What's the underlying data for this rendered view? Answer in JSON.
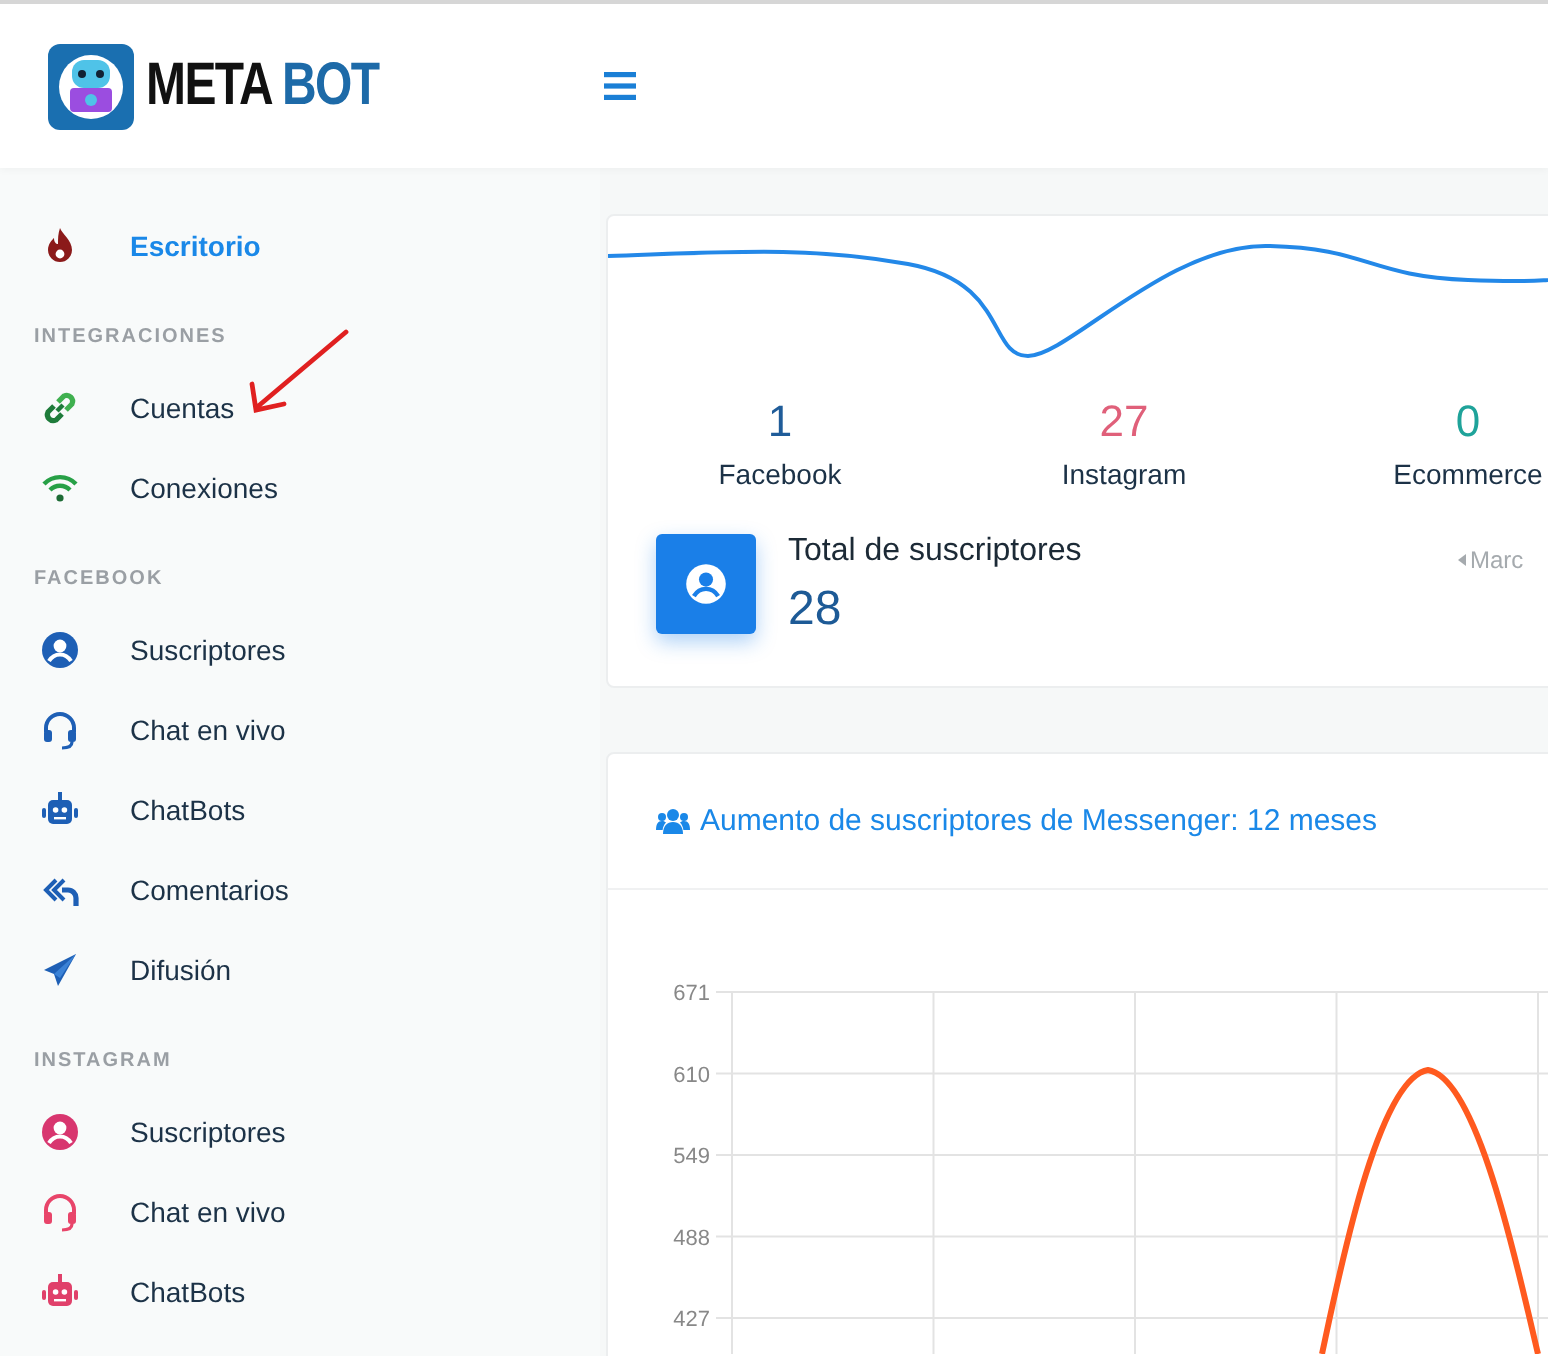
{
  "header": {
    "logo": {
      "text": "META",
      "accent": "BOT"
    }
  },
  "sidebar": {
    "top": [
      {
        "label": "Escritorio",
        "selected": true
      }
    ],
    "sections": [
      {
        "title": "INTEGRACIONES",
        "items": [
          {
            "label": "Cuentas",
            "selected": false
          },
          {
            "label": "Conexiones",
            "selected": false
          }
        ]
      },
      {
        "title": "FACEBOOK",
        "items": [
          {
            "label": "Suscriptores",
            "selected": false
          },
          {
            "label": "Chat en vivo",
            "selected": false
          },
          {
            "label": "ChatBots",
            "selected": false
          },
          {
            "label": "Comentarios",
            "selected": false
          },
          {
            "label": "Difusión",
            "selected": false
          }
        ]
      },
      {
        "title": "INSTAGRAM",
        "items": [
          {
            "label": "Suscriptores",
            "selected": false
          },
          {
            "label": "Chat en vivo",
            "selected": false
          },
          {
            "label": "ChatBots",
            "selected": false
          }
        ]
      }
    ]
  },
  "summary": {
    "stats": [
      {
        "value": "1",
        "label": "Facebook",
        "color": "#1f5c99"
      },
      {
        "value": "27",
        "label": "Instagram",
        "color": "#e0607a"
      },
      {
        "value": "0",
        "label": "Ecommerce",
        "color": "#1fa39a"
      }
    ],
    "total": {
      "label": "Total de suscriptores",
      "value": "28"
    },
    "pager": "Marc"
  },
  "growth": {
    "title": "Aumento de suscriptores de Messenger: 12 meses",
    "y_axis_labels": [
      "671",
      "610",
      "549",
      "488",
      "427"
    ]
  }
}
